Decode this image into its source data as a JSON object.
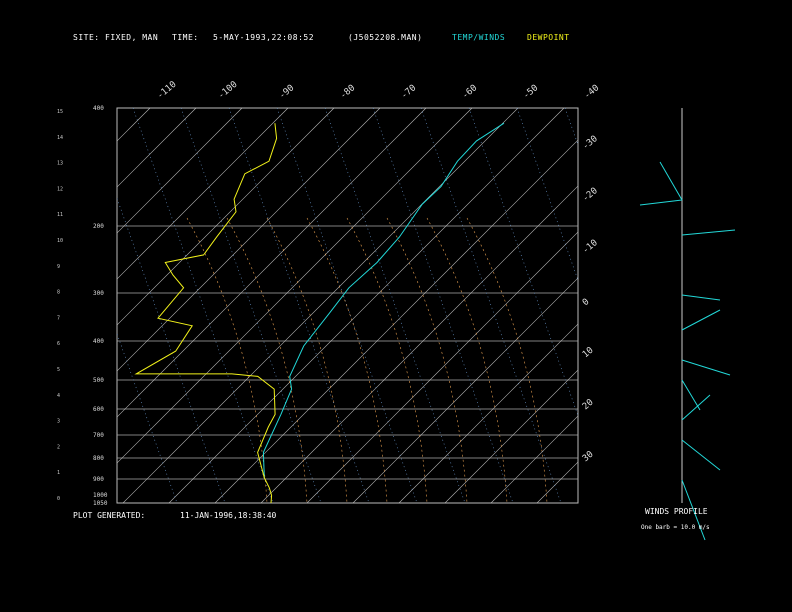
{
  "header": {
    "site_label": "SITE:",
    "site_value": "FIXED, MAN",
    "time_label": "TIME:",
    "time_value": "5-MAY-1993,22:08:52",
    "file": "(J5052208.MAN)",
    "legend_temp": "TEMP/WINDS",
    "legend_dew": "DEWPOINT"
  },
  "footer": {
    "generated_label": "PLOT GENERATED:",
    "generated_value": "11-JAN-1996,18:38:40",
    "winds_title": "WINDS PROFILE",
    "winds_note": "One barb = 10.0 m/s"
  },
  "colors": {
    "temp": "#22d8d8",
    "dew": "#f2f21a",
    "grid": "#c8c8c8",
    "mixing": "#e8a050",
    "moist": "#d08840",
    "dry": "#6f9fd8"
  },
  "chart_data": {
    "type": "line",
    "title": "",
    "xlabel": "",
    "ylabel": "",
    "pressure_levels_labeled": [
      400,
      200,
      300,
      400,
      500,
      600,
      700,
      800,
      900,
      1000,
      1050
    ],
    "pressure_tick_labels": [
      "400",
      "200",
      "300",
      "400",
      "500",
      "600",
      "700",
      "800",
      "900",
      "1000",
      "1050"
    ],
    "height_km_labels": [
      "15",
      "14",
      "13",
      "12",
      "11",
      "10",
      "9",
      "8",
      "7",
      "6",
      "5",
      "4",
      "3",
      "2",
      "1",
      "0"
    ],
    "temp_top_labels": [
      "-110",
      "-100",
      "-90",
      "-80",
      "-70",
      "-60",
      "-50",
      "-40"
    ],
    "temp_right_labels": [
      "-30",
      "-20",
      "-10",
      "0",
      "10",
      "20",
      "30"
    ],
    "series": [
      {
        "name": "TEMP/WINDS",
        "points": [
          [
            1.0,
            -13
          ],
          [
            2.0,
            -14
          ],
          [
            3.5,
            -9
          ],
          [
            4.5,
            -6
          ],
          [
            5.0,
            -7
          ],
          [
            6.2,
            -3
          ],
          [
            7.5,
            5
          ],
          [
            8.5,
            11
          ],
          [
            9.5,
            20
          ],
          [
            10.5,
            27
          ],
          [
            11.8,
            34
          ],
          [
            12.5,
            40
          ],
          [
            13.5,
            45
          ],
          [
            14.3,
            51
          ],
          [
            15.0,
            60
          ]
        ]
      },
      {
        "name": "DEWPOINT",
        "points": [
          [
            0.0,
            -10
          ],
          [
            0.3,
            -10
          ],
          [
            0.6,
            -11
          ],
          [
            1.0,
            -13
          ],
          [
            2.0,
            -16
          ],
          [
            3.0,
            -13
          ],
          [
            3.5,
            -11
          ],
          [
            4.5,
            -12
          ],
          [
            5.0,
            -18
          ],
          [
            5.1,
            -27
          ],
          [
            5.1,
            -60
          ],
          [
            6.0,
            -47
          ],
          [
            7.0,
            -42
          ],
          [
            7.3,
            -54
          ],
          [
            8.5,
            -46
          ],
          [
            9.0,
            -50
          ],
          [
            9.5,
            -53
          ],
          [
            9.8,
            -40
          ],
          [
            10.5,
            -36
          ],
          [
            11.5,
            -30
          ],
          [
            12.0,
            -31
          ],
          [
            13.0,
            -28
          ],
          [
            13.5,
            -20
          ],
          [
            14.4,
            -18
          ],
          [
            15.0,
            -19
          ]
        ]
      }
    ]
  }
}
